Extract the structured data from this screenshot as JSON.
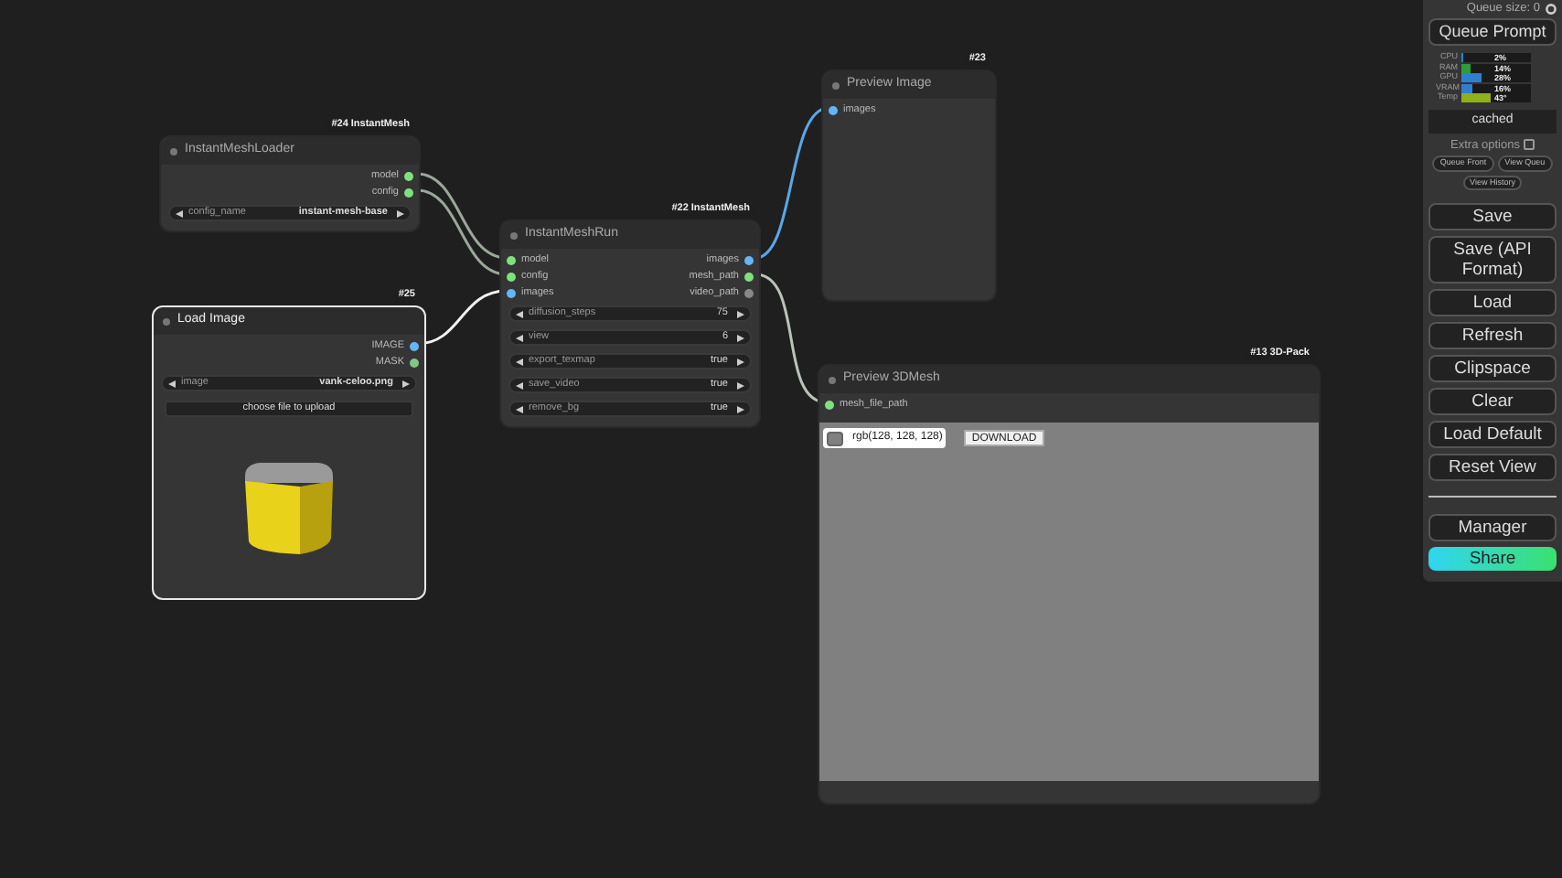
{
  "nodes": [
    {
      "kind": "basic",
      "selected": false,
      "badge": "#24 InstantMesh",
      "title": "InstantMeshLoader",
      "outputs": [
        {
          "name": "model",
          "color": "#7ee07e"
        },
        {
          "name": "config",
          "color": "#7ee07e"
        }
      ],
      "widgets": [
        {
          "kind": "combo",
          "name": "config_name",
          "value": "instant-mesh-base"
        }
      ]
    },
    {
      "kind": "image",
      "selected": true,
      "badge": "#25",
      "title": "Load Image",
      "outputs": [
        {
          "name": "IMAGE",
          "color": "#64b5f6"
        },
        {
          "name": "MASK",
          "color": "#81c784"
        }
      ],
      "widgets": [
        {
          "kind": "combo",
          "name": "image",
          "value": "vank-celoo.png"
        }
      ],
      "upload": "choose file to upload"
    },
    {
      "kind": "basic",
      "selected": false,
      "badge": "#22 InstantMesh",
      "title": "InstantMeshRun",
      "inputs": [
        {
          "name": "model",
          "color": "#7ee07e"
        },
        {
          "name": "config",
          "color": "#7ee07e"
        },
        {
          "name": "images",
          "color": "#64b5f6"
        }
      ],
      "outputs": [
        {
          "name": "images",
          "color": "#64b5f6"
        },
        {
          "name": "mesh_path",
          "color": "#7ee07e"
        },
        {
          "name": "video_path",
          "color": "#888888"
        }
      ],
      "widgets": [
        {
          "kind": "number",
          "name": "diffusion_steps",
          "value": "75"
        },
        {
          "kind": "number",
          "name": "view",
          "value": "6"
        },
        {
          "kind": "toggle",
          "name": "export_texmap",
          "value": "true"
        },
        {
          "kind": "toggle",
          "name": "save_video",
          "value": "true"
        },
        {
          "kind": "toggle",
          "name": "remove_bg",
          "value": "true"
        }
      ]
    },
    {
      "kind": "basic",
      "selected": false,
      "badge": "#23",
      "title": "Preview Image",
      "inputs": [
        {
          "name": "images",
          "color": "#64b5f6"
        }
      ]
    },
    {
      "kind": "mesh",
      "selected": false,
      "badge": "#13 3D-Pack",
      "title": "Preview 3DMesh",
      "inputs": [
        {
          "name": "mesh_file_path",
          "color": "#7ee07e"
        }
      ],
      "swatch": "rgb(128, 128, 128)",
      "download": "DOWNLOAD"
    }
  ],
  "panel": {
    "queue_size": "Queue size: 0",
    "queue_button": "Queue Prompt",
    "meters": [
      {
        "label": "CPU",
        "reading": "2%",
        "level": 0.02,
        "color": "#2f7fd0"
      },
      {
        "label": "RAM",
        "reading": "14%",
        "level": 0.14,
        "color": "#2e9e3a"
      },
      {
        "label": "GPU",
        "reading": "28%",
        "level": 0.28,
        "color": "#2f7fd0"
      },
      {
        "label": "VRAM",
        "reading": "16%",
        "level": 0.16,
        "color": "#2f7fd0"
      },
      {
        "label": "Temp",
        "reading": "43°",
        "level": 0.43,
        "color": "#8fb01c"
      }
    ],
    "status": "cached",
    "extra_options": {
      "label": "Extra options",
      "checked": false
    },
    "small_buttons": [
      "Queue Front",
      "View Queu",
      "View History"
    ],
    "buttons": [
      "Save",
      "Save (API Format)",
      "Load",
      "Refresh",
      "Clipspace",
      "Clear",
      "Load Default",
      "Reset View"
    ],
    "bottom_buttons": [
      {
        "label": "Manager",
        "kind": "plain"
      },
      {
        "label": "Share",
        "kind": "share"
      }
    ]
  }
}
